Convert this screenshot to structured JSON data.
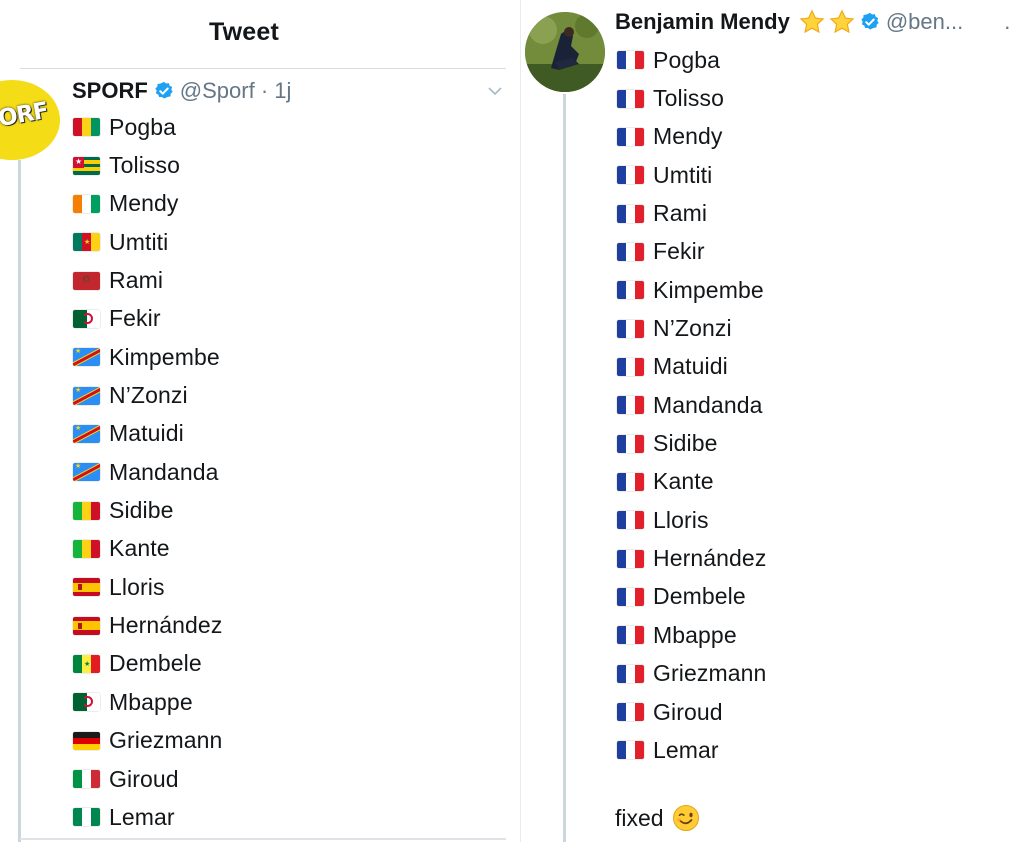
{
  "left": {
    "header_title": "Tweet",
    "avatar_text": "ORF",
    "display_name": "SPORF",
    "handle_time": "@Sporf · 1j",
    "players": [
      {
        "name": "Pogba",
        "flag": "guinea"
      },
      {
        "name": "Tolisso",
        "flag": "togo"
      },
      {
        "name": "Mendy",
        "flag": "ivory-coast"
      },
      {
        "name": "Umtiti",
        "flag": "cameroon"
      },
      {
        "name": "Rami",
        "flag": "morocco"
      },
      {
        "name": "Fekir",
        "flag": "algeria"
      },
      {
        "name": "Kimpembe",
        "flag": "dr-congo"
      },
      {
        "name": "N’Zonzi",
        "flag": "dr-congo"
      },
      {
        "name": "Matuidi",
        "flag": "dr-congo"
      },
      {
        "name": "Mandanda",
        "flag": "dr-congo"
      },
      {
        "name": "Sidibe",
        "flag": "mali"
      },
      {
        "name": "Kante",
        "flag": "mali"
      },
      {
        "name": "Lloris",
        "flag": "spain"
      },
      {
        "name": "Hernández",
        "flag": "spain"
      },
      {
        "name": "Dembele",
        "flag": "senegal"
      },
      {
        "name": "Mbappe",
        "flag": "algeria"
      },
      {
        "name": "Griezmann",
        "flag": "germany"
      },
      {
        "name": "Giroud",
        "flag": "italy"
      },
      {
        "name": "Lemar",
        "flag": "nigeria"
      }
    ]
  },
  "right": {
    "display_name": "Benjamin Mendy",
    "handle": "@ben...",
    "menu_dot": "·",
    "players": [
      {
        "name": "Pogba",
        "flag": "france"
      },
      {
        "name": "Tolisso",
        "flag": "france"
      },
      {
        "name": "Mendy",
        "flag": "france"
      },
      {
        "name": "Umtiti",
        "flag": "france"
      },
      {
        "name": "Rami",
        "flag": "france"
      },
      {
        "name": "Fekir",
        "flag": "france"
      },
      {
        "name": "Kimpembe",
        "flag": "france"
      },
      {
        "name": "N’Zonzi",
        "flag": "france"
      },
      {
        "name": "Matuidi",
        "flag": "france"
      },
      {
        "name": "Mandanda",
        "flag": "france"
      },
      {
        "name": "Sidibe",
        "flag": "france"
      },
      {
        "name": "Kante",
        "flag": "france"
      },
      {
        "name": "Lloris",
        "flag": "france"
      },
      {
        "name": "Hernández",
        "flag": "france"
      },
      {
        "name": "Dembele",
        "flag": "france"
      },
      {
        "name": "Mbappe",
        "flag": "france"
      },
      {
        "name": "Griezmann",
        "flag": "france"
      },
      {
        "name": "Giroud",
        "flag": "france"
      },
      {
        "name": "Lemar",
        "flag": "france"
      }
    ],
    "footer_text": "fixed"
  },
  "colors": {
    "verified": "#1da1f2",
    "muted": "#657786",
    "text": "#14171a",
    "sporf_yellow": "#f4dc16"
  },
  "icons": {
    "verified": "verified-badge-icon",
    "chevron": "chevron-down-icon",
    "star": "star-emoji",
    "wink": "winking-face-emoji"
  }
}
